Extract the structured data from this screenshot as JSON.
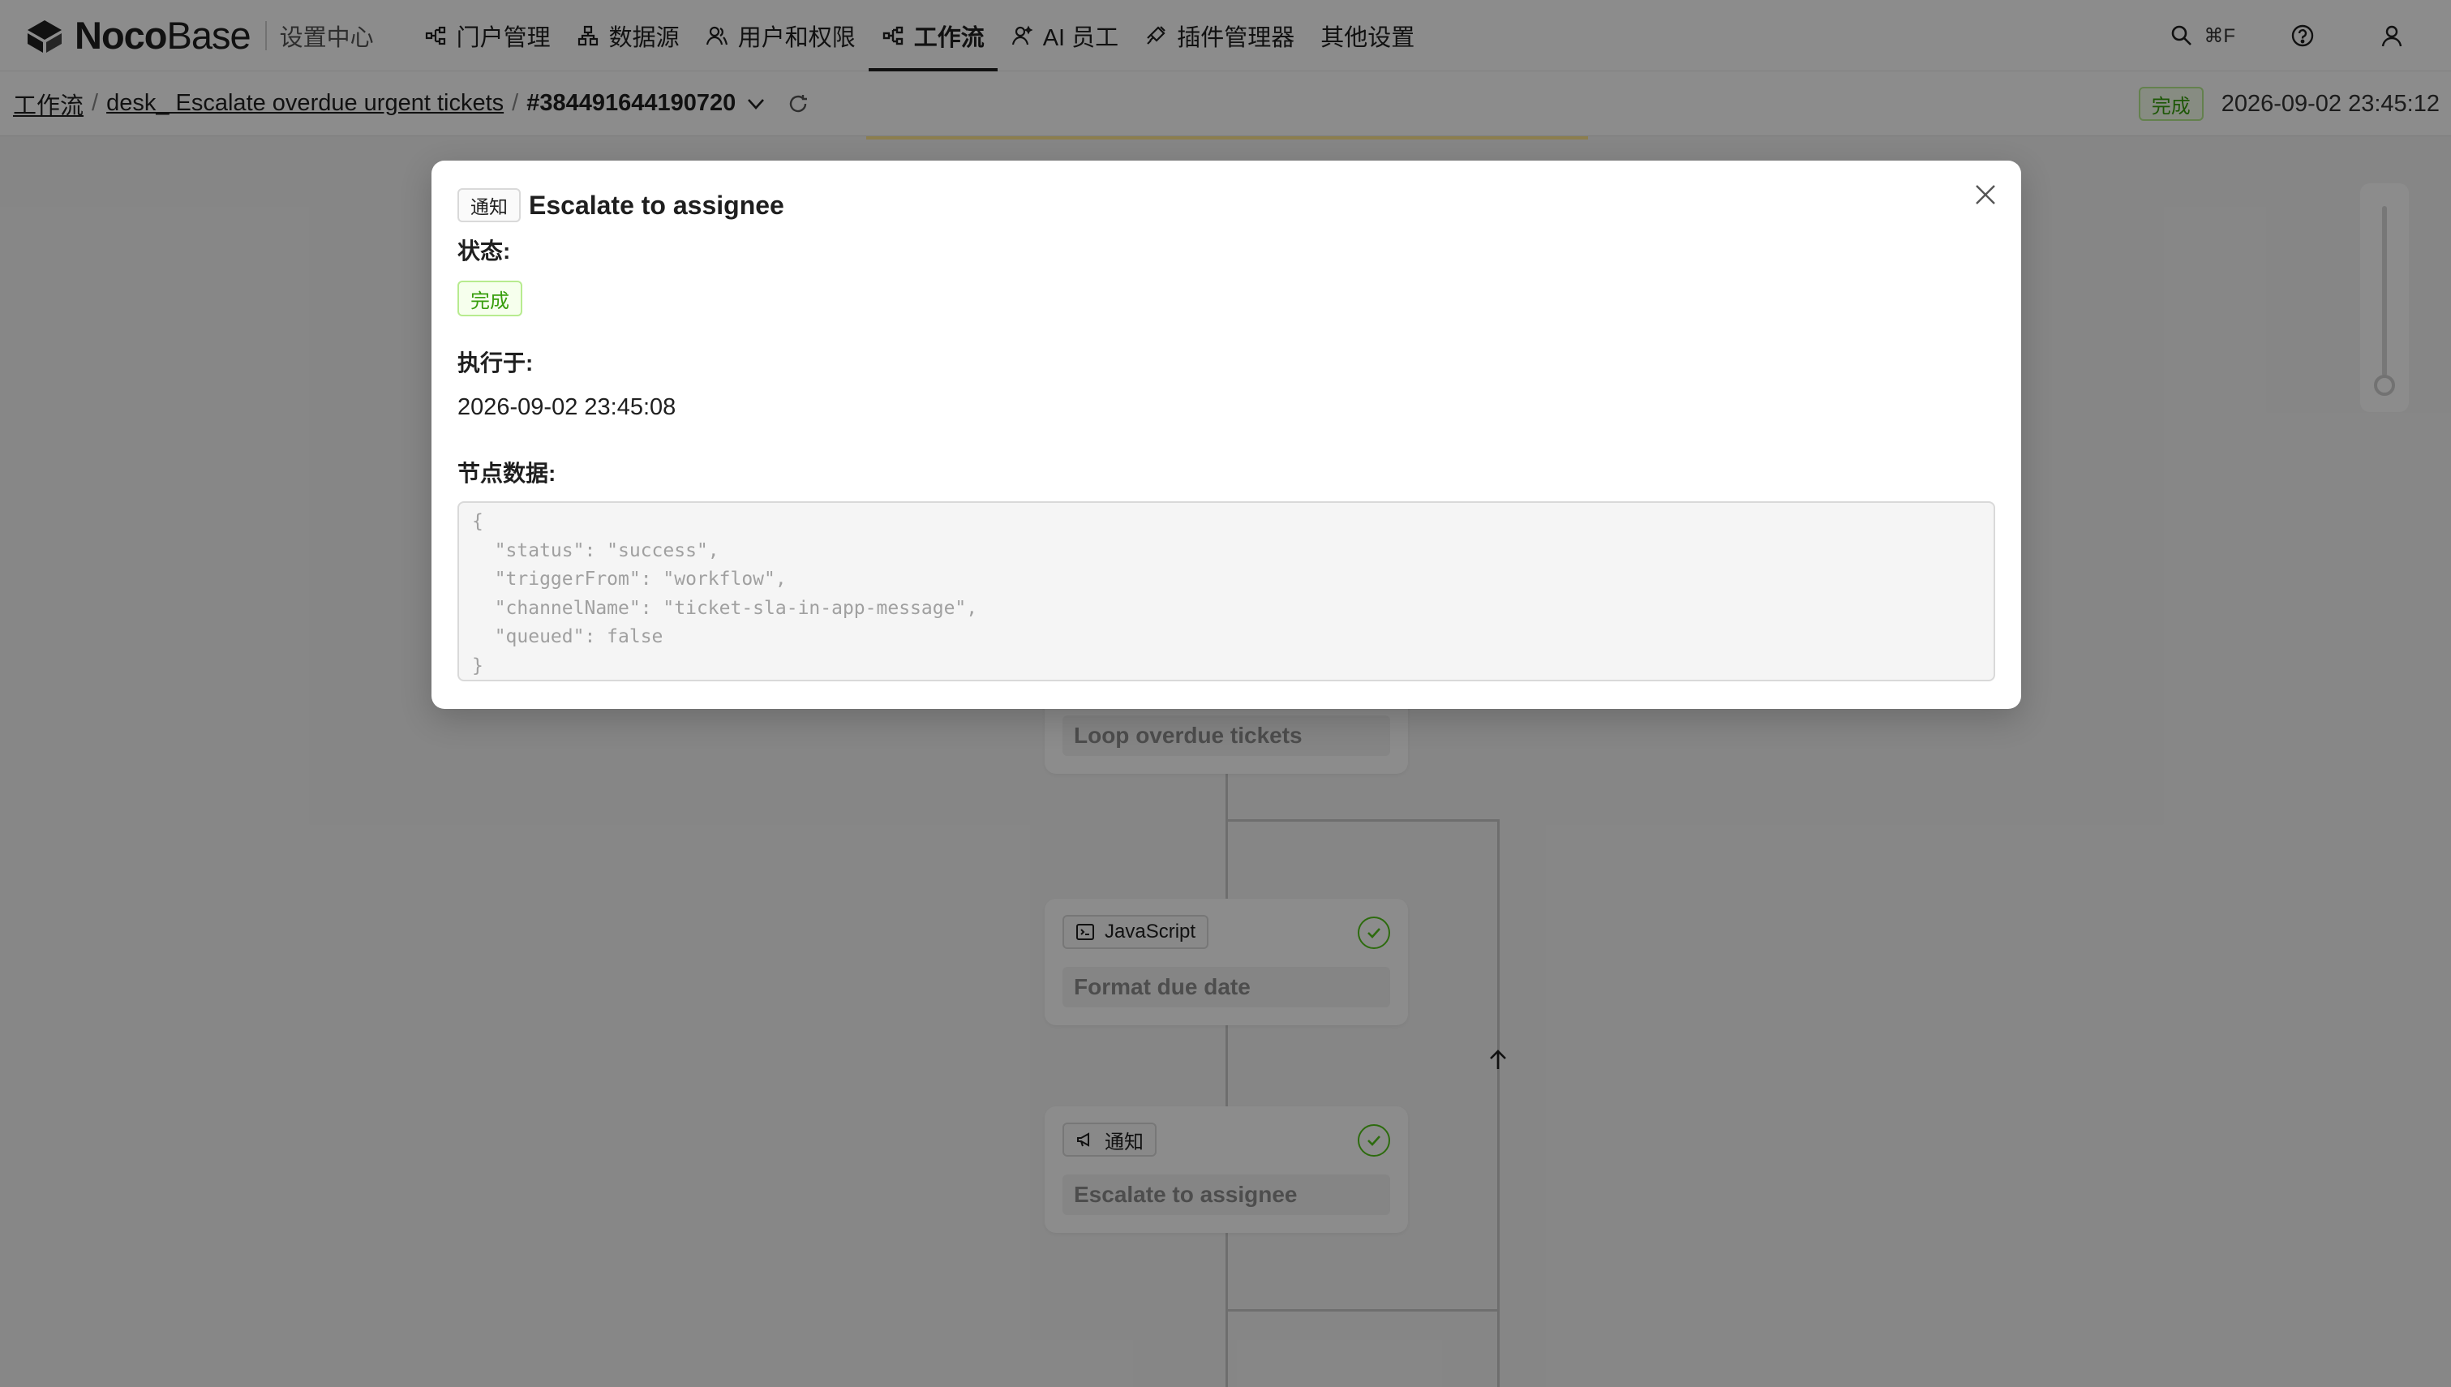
{
  "brand": {
    "noco": "Noco",
    "base": "Base",
    "subtitle": "设置中心"
  },
  "nav": {
    "items": [
      {
        "label": "门户管理",
        "icon": "workflow-nodes-icon",
        "active": false
      },
      {
        "label": "数据源",
        "icon": "database-tree-icon",
        "active": false
      },
      {
        "label": "用户和权限",
        "icon": "users-icon",
        "active": false
      },
      {
        "label": "工作流",
        "icon": "workflow-nodes-icon",
        "active": true
      },
      {
        "label": "AI 员工",
        "icon": "ai-user-icon",
        "active": false
      },
      {
        "label": "插件管理器",
        "icon": "plugin-icon",
        "active": false
      },
      {
        "label": "其他设置",
        "icon": "",
        "active": false
      }
    ]
  },
  "topright": {
    "search_shortcut": "⌘F",
    "search_icon": "search-icon",
    "help_icon": "help-icon",
    "user_icon": "user-icon"
  },
  "breadcrumb": {
    "root": "工作流",
    "workflow": "desk_ Escalate overdue urgent tickets",
    "execution": "#384491644190720",
    "separator": "/"
  },
  "execution_status": {
    "label": "完成",
    "time": "2026-09-02 23:45:12",
    "color": "#389e0d"
  },
  "canvas": {
    "nodes": [
      {
        "title": "Loop overdue tickets",
        "tag": "",
        "done": false
      },
      {
        "title": "Format due date",
        "tag": "JavaScript",
        "done": true
      },
      {
        "title": "Escalate to assignee",
        "tag": "通知",
        "done": true
      }
    ]
  },
  "modal": {
    "tag": "通知",
    "title": "Escalate to assignee",
    "status_label": "状态:",
    "status_value": "完成",
    "executed_label": "执行于:",
    "executed_value": "2026-09-02 23:45:08",
    "data_label": "节点数据:",
    "data_json": "{\n  \"status\": \"success\",\n  \"triggerFrom\": \"workflow\",\n  \"channelName\": \"ticket-sla-in-app-message\",\n  \"queued\": false\n}"
  },
  "colors": {
    "accent": "#1f1f1f",
    "success": "#52c41a",
    "success_bg": "#f6ffed",
    "success_border": "#b7eb8f",
    "overlay": "rgba(0,0,0,0.45)"
  }
}
